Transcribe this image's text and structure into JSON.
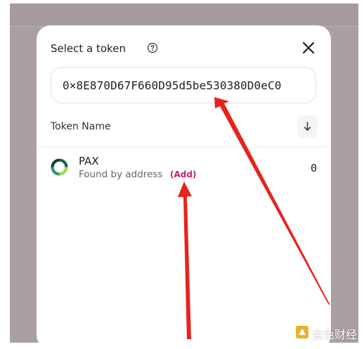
{
  "modal": {
    "title": "Select a token",
    "search": {
      "value": "0×8E870D67F660D95d5be530380D0eC0"
    },
    "list_header": {
      "column_label": "Token Name",
      "sort_icon": "arrow-down-icon"
    },
    "tokens": [
      {
        "symbol": "PAX",
        "subtitle": "Found by address",
        "add_label": "(Add)",
        "balance": "0",
        "logo_icon": "pax-logo-icon"
      }
    ]
  },
  "watermark": {
    "text": "金色财经"
  },
  "colors": {
    "backdrop": "#ab9fa6",
    "accent": "#c2216f",
    "arrow": "#e8231c"
  }
}
